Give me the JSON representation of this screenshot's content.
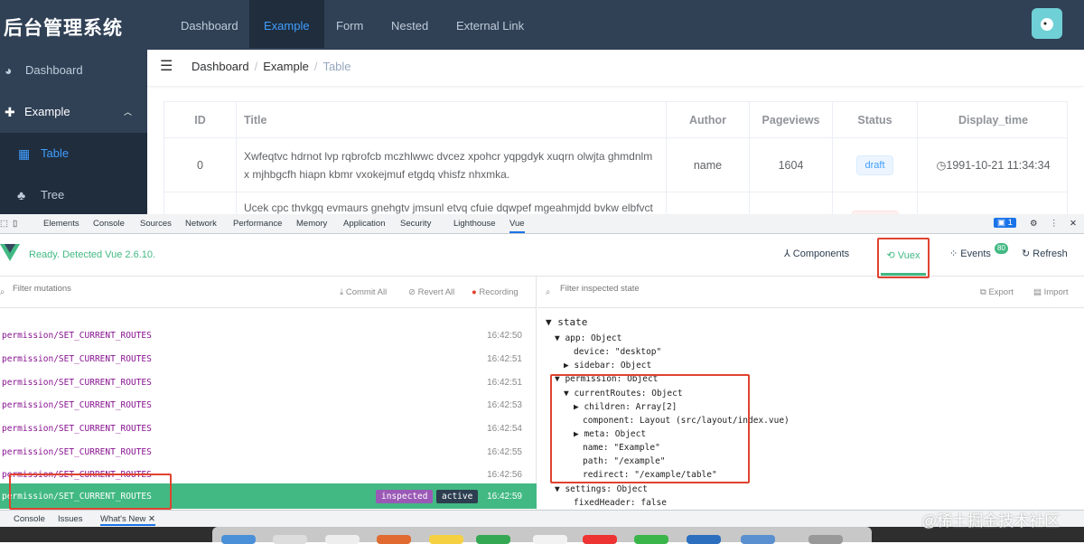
{
  "app": {
    "title": "后台管理系统",
    "top_nav": [
      "Dashboard",
      "Example",
      "Form",
      "Nested",
      "External Link"
    ]
  },
  "sidebar": {
    "items": [
      {
        "label": "Dashboard",
        "icon": "dashboard-icon"
      },
      {
        "label": "Example",
        "icon": "example-icon"
      },
      {
        "label": "Table",
        "icon": "table-icon"
      },
      {
        "label": "Tree",
        "icon": "tree-icon"
      }
    ]
  },
  "breadcrumb": {
    "items": [
      "Dashboard",
      "Example",
      "Table"
    ]
  },
  "table": {
    "headers": [
      "ID",
      "Title",
      "Author",
      "Pageviews",
      "Status",
      "Display_time"
    ],
    "rows": [
      {
        "id": "0",
        "title": "Xwfeqtvc hdrnot lvp rqbrofcb mczhlwwc dvcez xpohcr yqpgdyk xuqrn olwjta ghmdnlm x mjhbgcfh hiapn kbmr vxokejmuf etgdq vhisfz nhxmka.",
        "author": "name",
        "pageviews": "1604",
        "status": "draft",
        "time": "1991-10-21 11:34:34"
      },
      {
        "title": "Ucek cpc thvkgq evmaurs gnehgtv jmsunl etvq cfuie dqwpef mgeahmjdd bvkw elbfvct"
      }
    ]
  },
  "devtools": {
    "tabs": [
      "Elements",
      "Console",
      "Sources",
      "Network",
      "Performance",
      "Memory",
      "Application",
      "Security",
      "Lighthouse",
      "Vue"
    ],
    "issues_count": "1"
  },
  "vue": {
    "ready": "Ready. Detected Vue 2.6.10.",
    "tabs": {
      "components": "Components",
      "vuex": "Vuex",
      "events": "Events",
      "events_count": "80",
      "refresh": "Refresh"
    }
  },
  "mutations": {
    "filter_placeholder": "Filter mutations",
    "commit_all": "Commit All",
    "revert_all": "Revert All",
    "recording": "Recording",
    "list": [
      {
        "name": "permission/SET_CURRENT_ROUTES",
        "time": "16:42:50"
      },
      {
        "name": "permission/SET_CURRENT_ROUTES",
        "time": "16:42:51"
      },
      {
        "name": "permission/SET_CURRENT_ROUTES",
        "time": "16:42:51"
      },
      {
        "name": "permission/SET_CURRENT_ROUTES",
        "time": "16:42:53"
      },
      {
        "name": "permission/SET_CURRENT_ROUTES",
        "time": "16:42:54"
      },
      {
        "name": "permission/SET_CURRENT_ROUTES",
        "time": "16:42:55"
      },
      {
        "name": "permission/SET_CURRENT_ROUTES",
        "time": "16:42:56"
      },
      {
        "name": "permission/SET_CURRENT_ROUTES",
        "time": "16:42:59",
        "inspected": "inspected",
        "active": "active"
      }
    ]
  },
  "state": {
    "filter_placeholder": "Filter inspected state",
    "export": "Export",
    "import": "Import",
    "lines": [
      {
        "t": "▼ state",
        "k": ""
      },
      {
        "t": "▼ app: Object",
        "k": "app"
      },
      {
        "t": "device: \"desktop\"",
        "k": "device"
      },
      {
        "t": "▶ sidebar: Object",
        "k": "sidebar"
      },
      {
        "t": "▼ permission: Object",
        "k": "permission"
      },
      {
        "t": "▼ currentRoutes: Object",
        "k": "currentRoutes"
      },
      {
        "t": "▶ children: Array[2]",
        "k": "children"
      },
      {
        "t": "component: Layout (src/layout/index.vue)",
        "k": "component"
      },
      {
        "t": "▶ meta: Object",
        "k": "meta"
      },
      {
        "t": "name: \"Example\"",
        "k": "name"
      },
      {
        "t": "path: \"/example\"",
        "k": "path"
      },
      {
        "t": "redirect: \"/example/table\"",
        "k": "redirect"
      },
      {
        "t": "▼ settings: Object",
        "k": "settings"
      },
      {
        "t": "fixedHeader: false",
        "k": "fixedHeader"
      }
    ]
  },
  "bottom": {
    "tabs": [
      "Console",
      "Issues",
      "What's New"
    ]
  },
  "watermark": "@稀土掘金技术社区"
}
